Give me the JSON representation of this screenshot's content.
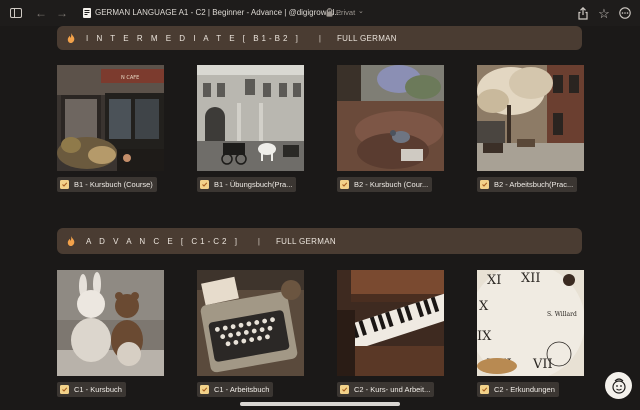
{
  "browser": {
    "page_title": "GERMAN LANGUAGE A1 - C2 | Beginner - Advance | @digigrow.id...",
    "privacy_label": "Privat",
    "icons": [
      "sidebar-icon",
      "back-icon",
      "forward-icon",
      "lock-icon",
      "share-icon",
      "bookmark-star-icon",
      "more-icon"
    ]
  },
  "sections": [
    {
      "title": "I N T E R M E D I A T E [ B1-B2 ]",
      "divider": "|",
      "subtitle": "FULL GERMAN",
      "cards": [
        {
          "label": "B1 - Kursbuch (Course)"
        },
        {
          "label": "B1 - Übungsbuch(Pra..."
        },
        {
          "label": "B2 - Kursbuch (Cour..."
        },
        {
          "label": "B2 - Arbeitsbuch(Prac..."
        }
      ]
    },
    {
      "title": "A D V A N C E [ C1-C2 ]",
      "divider": "|",
      "subtitle": "FULL GERMAN",
      "cards": [
        {
          "label": "C1 - Kursbuch"
        },
        {
          "label": "C1 - Arbeitsbuch"
        },
        {
          "label": "C2 - Kurs- und Arbeit..."
        },
        {
          "label": "C2 - Erkundungen"
        }
      ]
    }
  ],
  "colors": {
    "background": "#1b1918",
    "section_header": "#4a3c32",
    "label_bg": "#3b3632",
    "accent_flame": "#f2a14a"
  }
}
